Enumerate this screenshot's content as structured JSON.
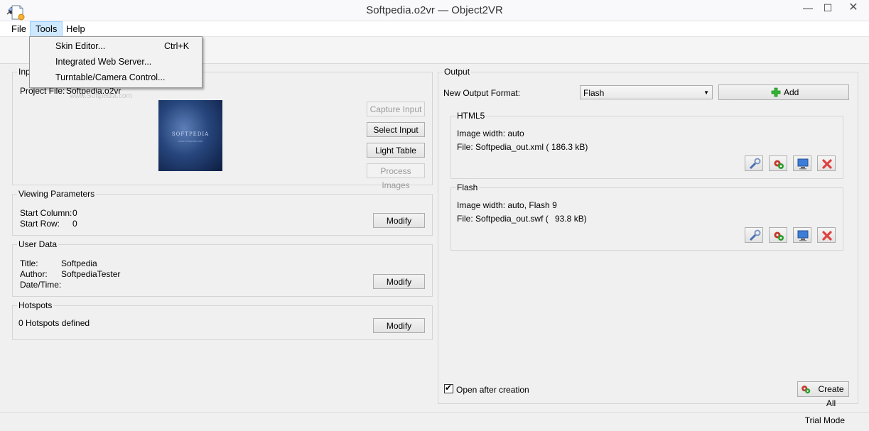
{
  "window": {
    "title": "Softpedia.o2vr — Object2VR",
    "minimize": "—",
    "maximize": "☐",
    "close": "✕"
  },
  "menubar": {
    "file": "File",
    "tools": "Tools",
    "help": "Help"
  },
  "tools_menu": {
    "items": [
      {
        "label": "Skin Editor...",
        "shortcut": "Ctrl+K"
      },
      {
        "label": "Integrated Web Server...",
        "shortcut": ""
      },
      {
        "label": "Turntable/Camera Control...",
        "shortcut": ""
      }
    ]
  },
  "input": {
    "title": "Inp",
    "project_label": "Project File:",
    "project_value": "Softpedia.o2vr",
    "watermark": "www.Softpedia.com",
    "thumb_text": "SOFTPEDIA",
    "thumb_sub": "www.softpedia.com",
    "buttons": {
      "capture": "Capture Input",
      "select": "Select Input",
      "light_table": "Light Table",
      "process": "Process Images"
    }
  },
  "viewing": {
    "title": "Viewing Parameters",
    "start_column_label": "Start Column:",
    "start_column_value": "0",
    "start_row_label": "Start Row:",
    "start_row_value": "0",
    "modify": "Modify"
  },
  "user_data": {
    "title": "User Data",
    "title_label": "Title:",
    "title_value": "Softpedia",
    "author_label": "Author:",
    "author_value": "SoftpediaTester",
    "datetime_label": "Date/Time:",
    "modify": "Modify"
  },
  "hotspots": {
    "title": "Hotspots",
    "status": "0 Hotspots defined",
    "modify": "Modify"
  },
  "output": {
    "title": "Output",
    "format_label": "New Output Format:",
    "format_value": "Flash",
    "add": "Add",
    "html5": {
      "title": "HTML5",
      "image_width": "Image width: auto",
      "file": "File: Softpedia_out.xml (",
      "size": "186.3 kB)"
    },
    "flash": {
      "title": "Flash",
      "image_width": "Image width: auto, Flash 9",
      "file": "File: Softpedia_out.swf (",
      "size": "93.8 kB)"
    },
    "open_after": "Open after creation",
    "open_after_checked": "✔",
    "create_all": "Create All"
  },
  "status": {
    "mode": "Trial Mode"
  },
  "colors": {
    "menu_highlight": "#cde8ff",
    "add_green": "#2fb52f",
    "delete_red": "#e04040"
  }
}
